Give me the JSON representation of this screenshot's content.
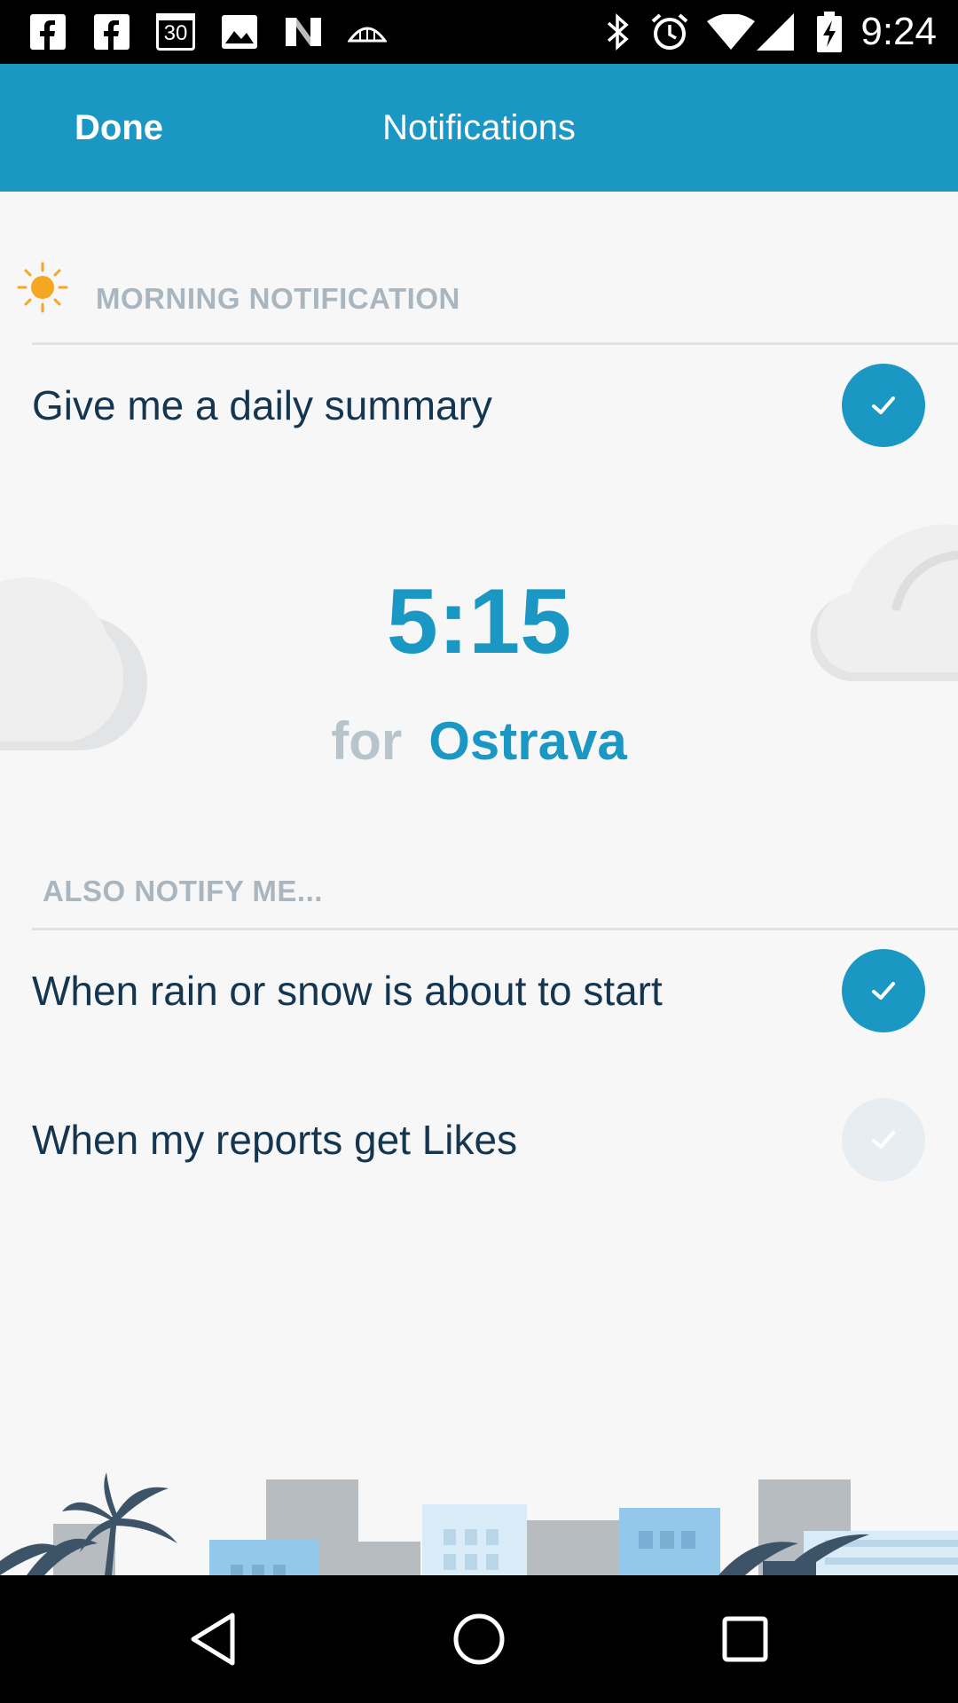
{
  "status_bar": {
    "time": "9:24",
    "left_icons": [
      "facebook-icon",
      "facebook-icon",
      "calendar-icon",
      "gallery-icon",
      "n-app-icon",
      "weather-app-icon"
    ],
    "calendar_day": "30",
    "right_icons": [
      "bluetooth-icon",
      "alarm-icon",
      "wifi-icon",
      "signal-icon",
      "battery-charging-icon"
    ]
  },
  "app_bar": {
    "done_label": "Done",
    "title": "Notifications",
    "color": "#1a97c2"
  },
  "morning": {
    "header": "MORNING NOTIFICATION",
    "icon": "sun-icon",
    "daily_summary": {
      "label": "Give me a daily summary",
      "checked": true
    },
    "time": "5:15",
    "for_label": "for",
    "city": "Ostrava"
  },
  "also": {
    "header": "ALSO NOTIFY ME...",
    "items": [
      {
        "label": "When rain or snow is about to start",
        "checked": true
      },
      {
        "label": "When my reports get Likes",
        "checked": false
      }
    ]
  },
  "nav": {
    "icons": [
      "back-icon",
      "home-icon",
      "recents-icon"
    ]
  },
  "colors": {
    "accent": "#1a97c2",
    "text_dark": "#143650",
    "header_grey": "#a9b6bf"
  }
}
